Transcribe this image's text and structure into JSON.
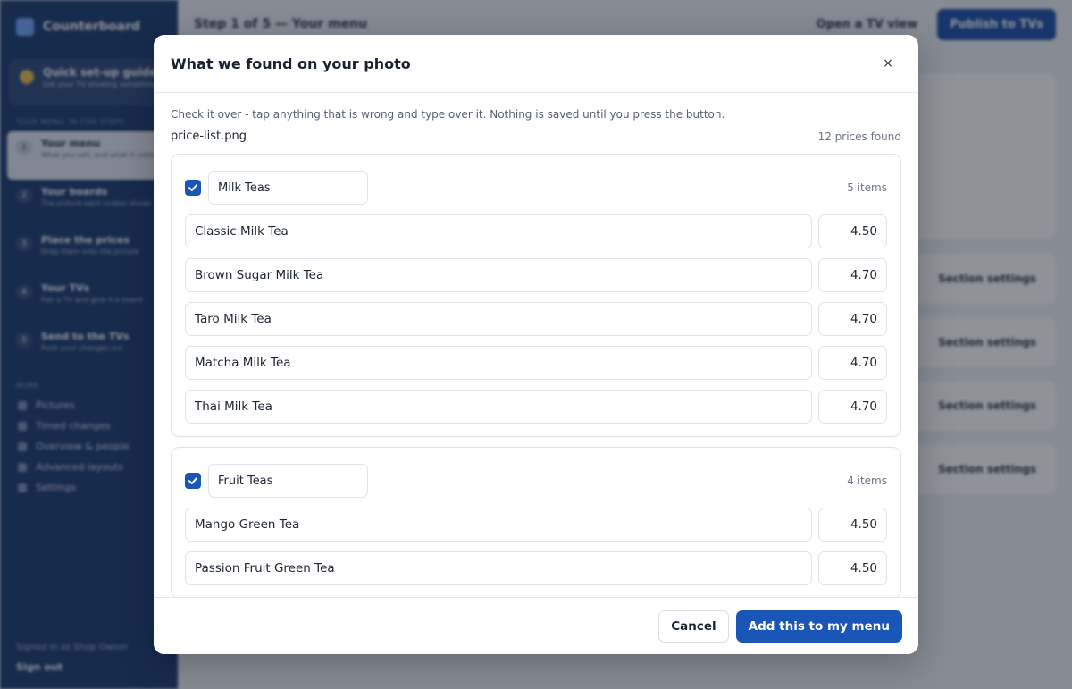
{
  "app": {
    "brand": "Counterboard",
    "guide": {
      "title": "Quick set-up guide",
      "subtitle": "Get your TV showing something"
    },
    "steps_heading": "YOUR MENU, IN FIVE STEPS",
    "steps": [
      {
        "num": "1",
        "title": "Your menu",
        "sub": "What you sell, and what it costs"
      },
      {
        "num": "2",
        "title": "Your boards",
        "sub": "The picture each screen shows"
      },
      {
        "num": "3",
        "title": "Place the prices",
        "sub": "Drag them onto the picture"
      },
      {
        "num": "4",
        "title": "Your TVs",
        "sub": "Pair a TV and give it a board"
      },
      {
        "num": "5",
        "title": "Send to the TVs",
        "sub": "Push your changes out"
      }
    ],
    "more_heading": "MORE",
    "more_links": [
      "Pictures",
      "Timed changes",
      "Overview & people",
      "Advanced layouts",
      "Settings"
    ],
    "signed_in": "Signed in as Shop Owner",
    "sign_out": "Sign out",
    "top_title": "Step 1 of 5 — Your menu",
    "open_tv": "Open a TV view",
    "publish": "Publish to TVs",
    "section_settings": "Section settings"
  },
  "modal": {
    "title": "What we found on your photo",
    "close_glyph": "×",
    "hint": "Check it over - tap anything that is wrong and type over it. Nothing is saved until you press the button.",
    "file_name": "price-list.png",
    "prices_found": "12 prices found",
    "groups": [
      {
        "name": "Milk Teas",
        "count": "5 items",
        "items": [
          {
            "name": "Classic Milk Tea",
            "price": "4.50"
          },
          {
            "name": "Brown Sugar Milk Tea",
            "price": "4.70"
          },
          {
            "name": "Taro Milk Tea",
            "price": "4.70"
          },
          {
            "name": "Matcha Milk Tea",
            "price": "4.70"
          },
          {
            "name": "Thai Milk Tea",
            "price": "4.70"
          }
        ]
      },
      {
        "name": "Fruit Teas",
        "count": "4 items",
        "items": [
          {
            "name": "Mango Green Tea",
            "price": "4.50"
          },
          {
            "name": "Passion Fruit Green Tea",
            "price": "4.50"
          }
        ]
      }
    ],
    "cancel": "Cancel",
    "add": "Add this to my menu"
  },
  "colors": {
    "accent": "#1a56b8",
    "sidebar": "#1a3a6e"
  }
}
